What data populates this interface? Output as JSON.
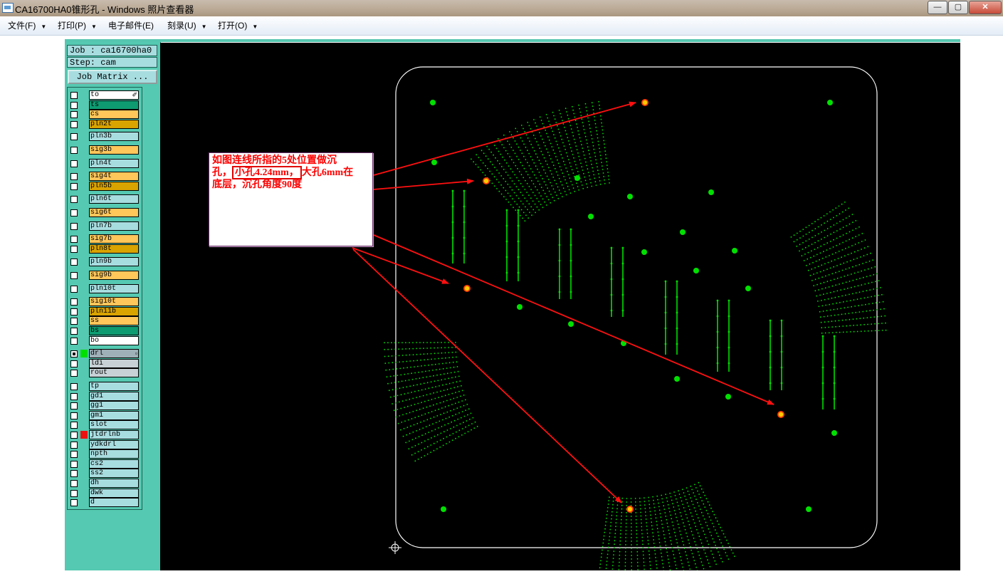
{
  "window": {
    "title": "CA16700HA0锥形孔 - Windows 照片查看器",
    "minimize_glyph": "—",
    "maximize_glyph": "▢",
    "close_glyph": "✕"
  },
  "menu": {
    "items": [
      {
        "label": "文件(F)",
        "has_dropdown": true
      },
      {
        "label": "打印(P)",
        "has_dropdown": true
      },
      {
        "label": "电子邮件(E)",
        "has_dropdown": false
      },
      {
        "label": "刻录(U)",
        "has_dropdown": true
      },
      {
        "label": "打开(O)",
        "has_dropdown": true
      }
    ]
  },
  "cam": {
    "job_label": "Job : ca16700ha0",
    "step_label": "Step: cam",
    "job_matrix_button": "Job Matrix ...",
    "layers": [
      {
        "name": "to",
        "color": "#ffffff",
        "checked": false,
        "marker": "✐"
      },
      {
        "name": "ts",
        "color": "#0e9b72",
        "checked": false
      },
      {
        "name": "cs",
        "color": "#ffc65a",
        "checked": false
      },
      {
        "name": "pln2t",
        "color": "#d9a300",
        "checked": false
      },
      {
        "name": "pln3b",
        "color": "#a8dde0",
        "checked": false
      },
      {
        "name": "sig3b",
        "color": "#ffc65a",
        "checked": false
      },
      {
        "name": "pln4t",
        "color": "#a8dde0",
        "checked": false
      },
      {
        "name": "sig4t",
        "color": "#ffc65a",
        "checked": false
      },
      {
        "name": "pln5b",
        "color": "#d9a300",
        "checked": false
      },
      {
        "name": "pln6t",
        "color": "#a8dde0",
        "checked": false
      },
      {
        "name": "sig6t",
        "color": "#ffc65a",
        "checked": false
      },
      {
        "name": "pln7b",
        "color": "#a8dde0",
        "checked": false
      },
      {
        "name": "sig7b",
        "color": "#ffc65a",
        "checked": false
      },
      {
        "name": "pln8t",
        "color": "#d9a300",
        "checked": false
      },
      {
        "name": "pln9b",
        "color": "#a8dde0",
        "checked": false
      },
      {
        "name": "sig9b",
        "color": "#ffc65a",
        "checked": false
      },
      {
        "name": "pln10t",
        "color": "#a8dde0",
        "checked": false
      },
      {
        "name": "sig10t",
        "color": "#ffc65a",
        "checked": false
      },
      {
        "name": "pln11b",
        "color": "#d9a300",
        "checked": false
      },
      {
        "name": "ss",
        "color": "#ffc65a",
        "checked": false
      },
      {
        "name": "bs",
        "color": "#0e9b72",
        "checked": false
      },
      {
        "name": "bo",
        "color": "#ffffff",
        "checked": false
      },
      {
        "name": "drl",
        "color": "#a0b0b8",
        "checked": true,
        "swatch": "#00e000",
        "marker": "▫"
      },
      {
        "name": "ldi",
        "color": "#c8d2d6",
        "checked": false
      },
      {
        "name": "rout",
        "color": "#c8d2d6",
        "checked": false
      },
      {
        "name": "tp",
        "color": "#a8dde0",
        "checked": false
      },
      {
        "name": "gd1",
        "color": "#a8dde0",
        "checked": false
      },
      {
        "name": "gg1",
        "color": "#a8dde0",
        "checked": false
      },
      {
        "name": "gm1",
        "color": "#a8dde0",
        "checked": false
      },
      {
        "name": "slot",
        "color": "#a8dde0",
        "checked": false
      },
      {
        "name": "jtdrlnb",
        "color": "#a8dde0",
        "checked": false,
        "swatch": "#ee1111"
      },
      {
        "name": "ydkdrl",
        "color": "#a8dde0",
        "checked": false
      },
      {
        "name": "npth",
        "color": "#a8dde0",
        "checked": false
      },
      {
        "name": "cs2",
        "color": "#a8dde0",
        "checked": false
      },
      {
        "name": "ss2",
        "color": "#a8dde0",
        "checked": false
      },
      {
        "name": "dh",
        "color": "#a8dde0",
        "checked": false
      },
      {
        "name": "dwk",
        "color": "#a8dde0",
        "checked": false
      },
      {
        "name": "d",
        "color": "#a8dde0",
        "checked": false
      }
    ]
  },
  "annotation": {
    "line1": "如图连线所指的5处位置做沉",
    "line2_prefix": "孔，",
    "line2_boxed": "小孔4.24mm，",
    "line2_suffix": "大孔6mm在",
    "line3": "底层，沉孔角度90度"
  },
  "colors": {
    "canvas_bg": "#000000",
    "pad_green": "#00e000",
    "highlight_hole": "#ffcc00",
    "arrow_red": "#ff1010",
    "outline_white": "#ffffff",
    "panel_teal": "#55c9b1"
  }
}
